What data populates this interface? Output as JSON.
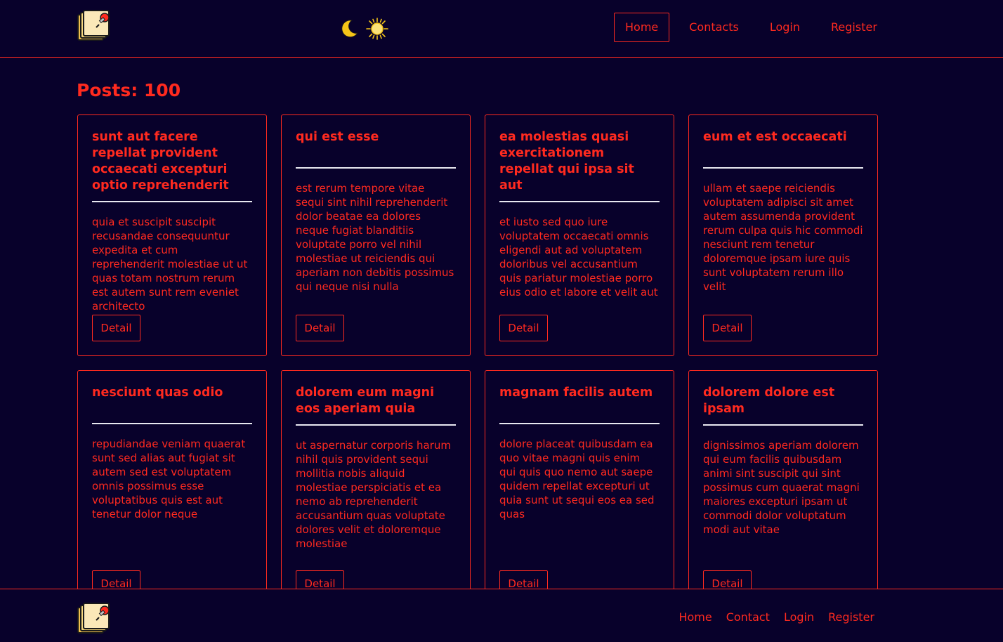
{
  "colors": {
    "background": "#08012b",
    "accent": "#ff2a1f",
    "divider": "#e8e8f0"
  },
  "header": {
    "logo_icon": "notes-pin-logo",
    "theme_icons": [
      "moon-icon",
      "sun-icon"
    ],
    "nav": [
      {
        "label": "Home",
        "active": true
      },
      {
        "label": "Contacts",
        "active": false
      },
      {
        "label": "Login",
        "active": false
      },
      {
        "label": "Register",
        "active": false
      }
    ]
  },
  "main": {
    "title": "Posts: 100",
    "detail_label": "Detail",
    "posts": [
      {
        "title": "sunt aut facere repellat provident occaecati excepturi optio reprehenderit",
        "body": "quia et suscipit suscipit recusandae consequuntur expedita et cum reprehenderit molestiae ut ut quas totam nostrum rerum est autem sunt rem eveniet architecto"
      },
      {
        "title": "qui est esse",
        "body": "est rerum tempore vitae sequi sint nihil reprehenderit dolor beatae ea dolores neque fugiat blanditiis voluptate porro vel nihil molestiae ut reiciendis qui aperiam non debitis possimus qui neque nisi nulla"
      },
      {
        "title": "ea molestias quasi exercitationem repellat qui ipsa sit aut",
        "body": "et iusto sed quo iure voluptatem occaecati omnis eligendi aut ad voluptatem doloribus vel accusantium quis pariatur molestiae porro eius odio et labore et velit aut"
      },
      {
        "title": "eum et est occaecati",
        "body": "ullam et saepe reiciendis voluptatem adipisci sit amet autem assumenda provident rerum culpa quis hic commodi nesciunt rem tenetur doloremque ipsam iure quis sunt voluptatem rerum illo velit"
      },
      {
        "title": "nesciunt quas odio",
        "body": "repudiandae veniam quaerat sunt sed alias aut fugiat sit autem sed est voluptatem omnis possimus esse voluptatibus quis est aut tenetur dolor neque"
      },
      {
        "title": "dolorem eum magni eos aperiam quia",
        "body": "ut aspernatur corporis harum nihil quis provident sequi mollitia nobis aliquid molestiae perspiciatis et ea nemo ab reprehenderit accusantium quas voluptate dolores velit et doloremque molestiae"
      },
      {
        "title": "magnam facilis autem",
        "body": "dolore placeat quibusdam ea quo vitae magni quis enim qui quis quo nemo aut saepe quidem repellat excepturi ut quia sunt ut sequi eos ea sed quas"
      },
      {
        "title": "dolorem dolore est ipsam",
        "body": "dignissimos aperiam dolorem qui eum facilis quibusdam animi sint suscipit qui sint possimus cum quaerat magni maiores excepturi ipsam ut commodi dolor voluptatum modi aut vitae"
      }
    ]
  },
  "footer": {
    "logo_icon": "notes-pin-logo",
    "nav": [
      "Home",
      "Contact",
      "Login",
      "Register"
    ]
  }
}
